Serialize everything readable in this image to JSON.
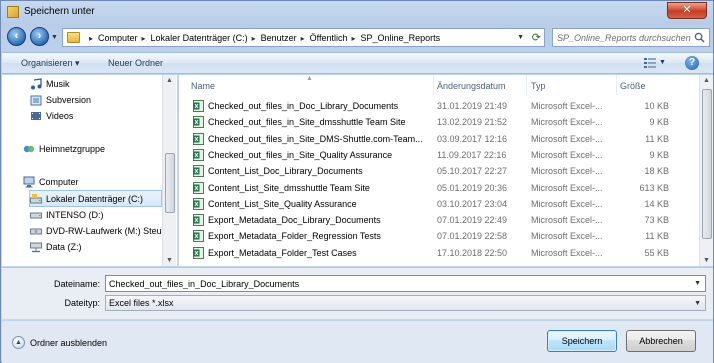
{
  "window": {
    "title": "Speichern unter",
    "close_label": "✕"
  },
  "address": {
    "crumbs": [
      "Computer",
      "Lokaler Datenträger (C:)",
      "Benutzer",
      "Öffentlich",
      "SP_Online_Reports"
    ],
    "search_placeholder": "SP_Online_Reports durchsuchen"
  },
  "toolbar": {
    "organize_label": "Organisieren ▾",
    "new_folder_label": "Neuer Ordner"
  },
  "nav": {
    "items": [
      {
        "label": "Musik",
        "icon": "music-icon"
      },
      {
        "label": "Subversion",
        "icon": "library-icon"
      },
      {
        "label": "Videos",
        "icon": "video-icon"
      },
      {
        "label": "Heimnetzgruppe",
        "icon": "homegroup-icon"
      },
      {
        "label": "Computer",
        "icon": "computer-icon"
      },
      {
        "label": "Lokaler Datenträger (C:)",
        "icon": "drive-icon",
        "selected": true
      },
      {
        "label": "INTENSO (D:)",
        "icon": "drive-icon"
      },
      {
        "label": "DVD-RW-Laufwerk (M:) Steu",
        "icon": "dvd-icon"
      },
      {
        "label": "Data (Z:)",
        "icon": "network-drive-icon"
      }
    ]
  },
  "columns": {
    "name": "Name",
    "date": "Änderungsdatum",
    "type": "Typ",
    "size": "Größe"
  },
  "files": [
    {
      "name": "Checked_out_files_in_Doc_Library_Documents",
      "date": "31.01.2019 21:49",
      "type": "Microsoft Excel-...",
      "size": "10 KB"
    },
    {
      "name": "Checked_out_files_in_Site_dmsshuttle Team Site",
      "date": "13.02.2019 21:52",
      "type": "Microsoft Excel-...",
      "size": "9 KB"
    },
    {
      "name": "Checked_out_files_in_Site_DMS-Shuttle.com-Team...",
      "date": "03.09.2017 12:16",
      "type": "Microsoft Excel-...",
      "size": "11 KB"
    },
    {
      "name": "Checked_out_files_in_Site_Quality Assurance",
      "date": "11.09.2017 22:16",
      "type": "Microsoft Excel-...",
      "size": "9 KB"
    },
    {
      "name": "Content_List_Doc_Library_Documents",
      "date": "05.10.2017 22:27",
      "type": "Microsoft Excel-...",
      "size": "18 KB"
    },
    {
      "name": "Content_List_Site_dmsshuttle Team Site",
      "date": "05.01.2019 20:36",
      "type": "Microsoft Excel-...",
      "size": "613 KB"
    },
    {
      "name": "Content_List_Site_Quality Assurance",
      "date": "03.10.2017 23:04",
      "type": "Microsoft Excel-...",
      "size": "14 KB"
    },
    {
      "name": "Export_Metadata_Doc_Library_Documents",
      "date": "07.01.2019 22:49",
      "type": "Microsoft Excel-...",
      "size": "73 KB"
    },
    {
      "name": "Export_Metadata_Folder_Regression Tests",
      "date": "07.01.2019 22:58",
      "type": "Microsoft Excel-...",
      "size": "11 KB"
    },
    {
      "name": "Export_Metadata_Folder_Test Cases",
      "date": "17.10.2018 22:50",
      "type": "Microsoft Excel-...",
      "size": "55 KB"
    }
  ],
  "form": {
    "filename_label": "Dateiname:",
    "filename_value": "Checked_out_files_in_Doc_Library_Documents",
    "filetype_label": "Dateityp:",
    "filetype_value": "Excel files *.xlsx"
  },
  "footer": {
    "hide_folders_label": "Ordner ausblenden",
    "save_label": "Speichern",
    "cancel_label": "Abbrechen"
  }
}
